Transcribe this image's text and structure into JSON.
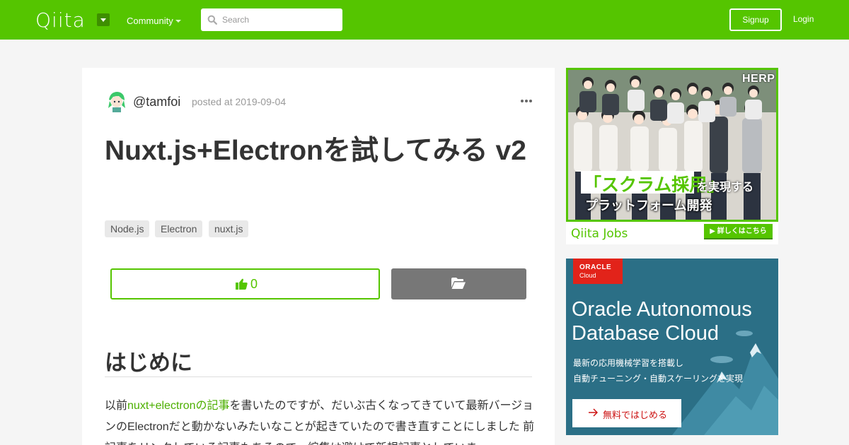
{
  "header": {
    "logo": "Qiita",
    "community_label": "Community",
    "search_placeholder": "Search",
    "signup_label": "Signup",
    "login_label": "Login"
  },
  "article": {
    "username": "@tamfoi",
    "posted": "posted at 2019-09-04",
    "title": "Nuxt.js+Electronを試してみる v2",
    "tags": [
      "Node.js",
      "Electron",
      "nuxt.js"
    ],
    "likes": "0",
    "section_heading": "はじめに",
    "paragraph": {
      "prefix": "以前",
      "link": "nuxt+electronの記事",
      "suffix": "を書いたのですが、だいぶ古くなってきていて最新バージョンのElectronだと動かないみたいなことが起きていたので書き直すことにしました 前記事をリンクしている記事もあるので、編集は避けて新規記事としていま"
    }
  },
  "ads": {
    "jobs": {
      "brand": "HERP",
      "headline_green": "「スクラム採用」",
      "headline_tail": "を実現する",
      "headline_line2": "プラットフォーム開発",
      "logo": "Qiita Jobs",
      "cta": "▶ 詳しくはこちら"
    },
    "oracle": {
      "badge_brand": "ORACLE",
      "badge_product": "Cloud",
      "title": "Oracle Autonomous Database Cloud",
      "sub_line1": "最新の応用機械学習を搭載し",
      "sub_line2": "自動チューニング・自動スケーリングを実現",
      "cta": "無料ではじめる"
    }
  },
  "colors": {
    "brand_green": "#55c500",
    "oracle_red": "#e2231a",
    "oracle_bg": "#2b6f86"
  }
}
